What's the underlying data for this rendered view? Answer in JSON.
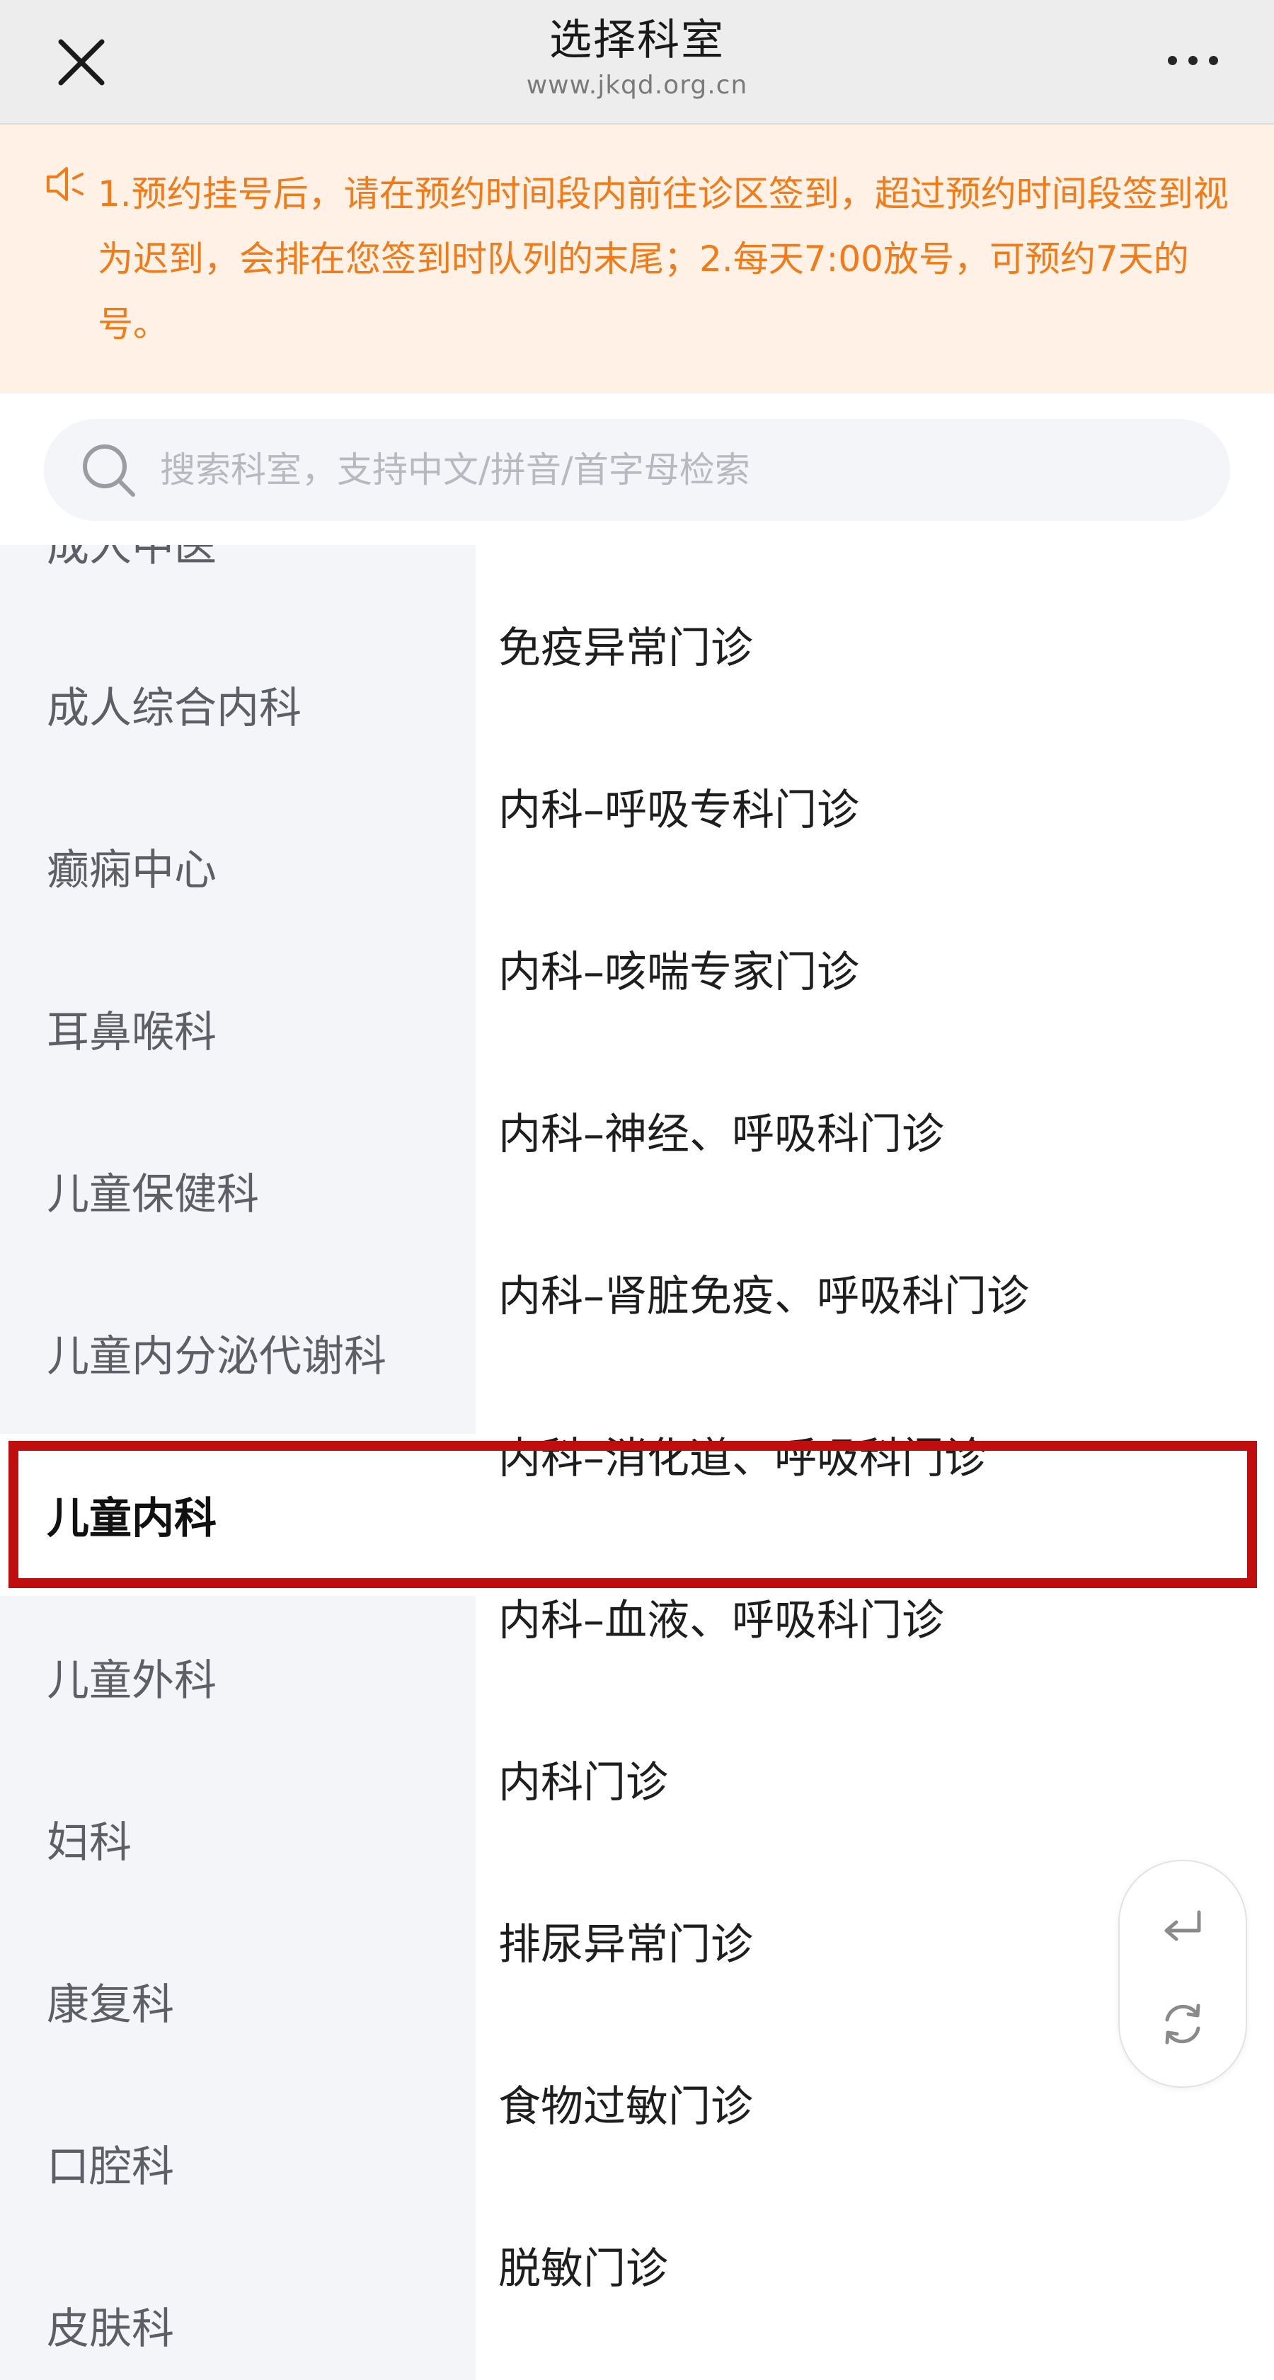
{
  "header": {
    "title": "选择科室",
    "subtitle": "www.jkqd.org.cn",
    "close_icon": "close-icon",
    "more_icon": "more-dots-icon"
  },
  "notice": {
    "icon": "speaker-icon",
    "text": "1.预约挂号后，请在预约时间段内前往诊区签到，超过预约时间段签到视为迟到，会排在您签到时队列的末尾；2.每天7:00放号，可预约7天的号。",
    "color": "#f27a17",
    "background": "#fff1e6"
  },
  "search": {
    "icon": "search-icon",
    "placeholder": "搜索科室，支持中文/拼音/首字母检索",
    "value": ""
  },
  "categories": [
    {
      "label": "成人中医"
    },
    {
      "label": "成人综合内科"
    },
    {
      "label": "癫痫中心"
    },
    {
      "label": "耳鼻喉科"
    },
    {
      "label": "儿童保健科"
    },
    {
      "label": "儿童内分泌代谢科"
    },
    {
      "label": "儿童内科",
      "selected": true
    },
    {
      "label": "儿童外科"
    },
    {
      "label": "妇科"
    },
    {
      "label": "康复科"
    },
    {
      "label": "口腔科"
    },
    {
      "label": "皮肤科"
    }
  ],
  "departments": [
    {
      "label": "免疫异常门诊"
    },
    {
      "label": "内科–呼吸专科门诊"
    },
    {
      "label": "内科–咳喘专家门诊"
    },
    {
      "label": "内科–神经、呼吸科门诊"
    },
    {
      "label": "内科–肾脏免疫、呼吸科门诊"
    },
    {
      "label": "内科–消化道、呼吸科门诊"
    },
    {
      "label": "内科–血液、呼吸科门诊"
    },
    {
      "label": "内科门诊"
    },
    {
      "label": "排尿异常门诊"
    },
    {
      "label": "食物过敏门诊"
    },
    {
      "label": "脱敏门诊"
    }
  ],
  "floating_actions": {
    "back_icon": "return-arrow-icon",
    "refresh_icon": "refresh-icon"
  },
  "colors": {
    "accent_highlight": "#c00e0e",
    "sidebar_bg": "#f4f5f9",
    "navbar_bg": "#ededed"
  }
}
